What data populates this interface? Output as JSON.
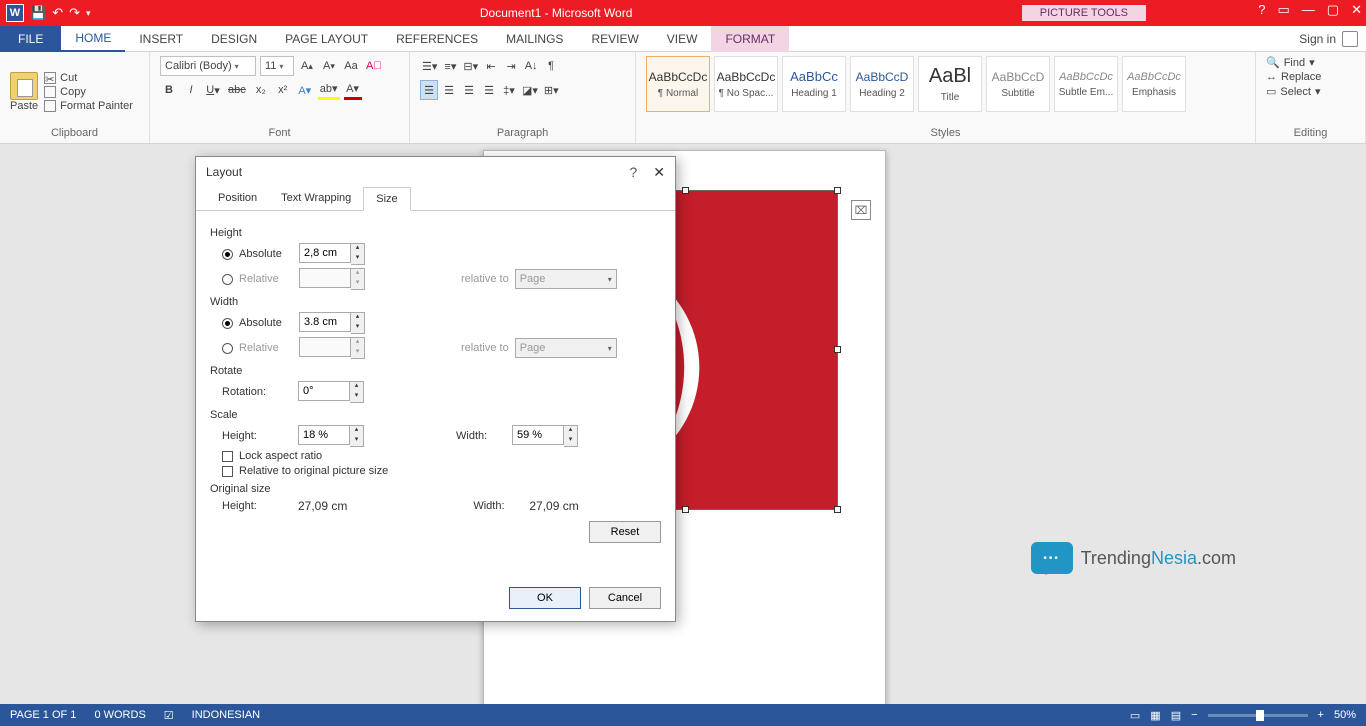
{
  "titlebar": {
    "title": "Document1 - Microsoft Word",
    "picture_tools": "PICTURE TOOLS"
  },
  "tabs": {
    "file": "FILE",
    "home": "HOME",
    "insert": "INSERT",
    "design": "DESIGN",
    "page_layout": "PAGE LAYOUT",
    "references": "REFERENCES",
    "mailings": "MAILINGS",
    "review": "REVIEW",
    "view": "VIEW",
    "format": "FORMAT",
    "signin": "Sign in"
  },
  "ribbon": {
    "clipboard": {
      "paste": "Paste",
      "cut": "Cut",
      "copy": "Copy",
      "format_painter": "Format Painter",
      "label": "Clipboard"
    },
    "font": {
      "name": "Calibri (Body)",
      "size": "11",
      "label": "Font"
    },
    "paragraph": {
      "label": "Paragraph"
    },
    "styles": {
      "label": "Styles",
      "items": [
        {
          "prev": "AaBbCcDc",
          "name": "¶ Normal"
        },
        {
          "prev": "AaBbCcDc",
          "name": "¶ No Spac..."
        },
        {
          "prev": "AaBbCc",
          "name": "Heading 1"
        },
        {
          "prev": "AaBbCcD",
          "name": "Heading 2"
        },
        {
          "prev": "AaBl",
          "name": "Title"
        },
        {
          "prev": "AaBbCcD",
          "name": "Subtitle"
        },
        {
          "prev": "AaBbCcDc",
          "name": "Subtle Em..."
        },
        {
          "prev": "AaBbCcDc",
          "name": "Emphasis"
        }
      ]
    },
    "editing": {
      "find": "Find",
      "replace": "Replace",
      "select": "Select",
      "label": "Editing"
    }
  },
  "dialog": {
    "title": "Layout",
    "tabs": {
      "position": "Position",
      "text_wrapping": "Text Wrapping",
      "size": "Size"
    },
    "height_label": "Height",
    "width_label": "Width",
    "absolute": "Absolute",
    "relative": "Relative",
    "relative_to": "relative to",
    "page": "Page",
    "height_abs": "2,8 cm",
    "width_abs": "3.8 cm",
    "rotate_label": "Rotate",
    "rotation": "Rotation:",
    "rotation_val": "0°",
    "scale_label": "Scale",
    "scale_height": "Height:",
    "scale_width": "Width:",
    "scale_h_val": "18 %",
    "scale_w_val": "59 %",
    "lock": "Lock aspect ratio",
    "rel_orig": "Relative to original picture size",
    "orig_label": "Original size",
    "orig_h": "Height:",
    "orig_w": "Width:",
    "orig_h_val": "27,09 cm",
    "orig_w_val": "27,09 cm",
    "reset": "Reset",
    "ok": "OK",
    "cancel": "Cancel"
  },
  "statusbar": {
    "page": "PAGE 1 OF 1",
    "words": "0 WORDS",
    "lang": "INDONESIAN",
    "zoom": "50%"
  },
  "watermark": {
    "brand1": "Trending",
    "brand2": "Nesia",
    "ext": ".com"
  }
}
